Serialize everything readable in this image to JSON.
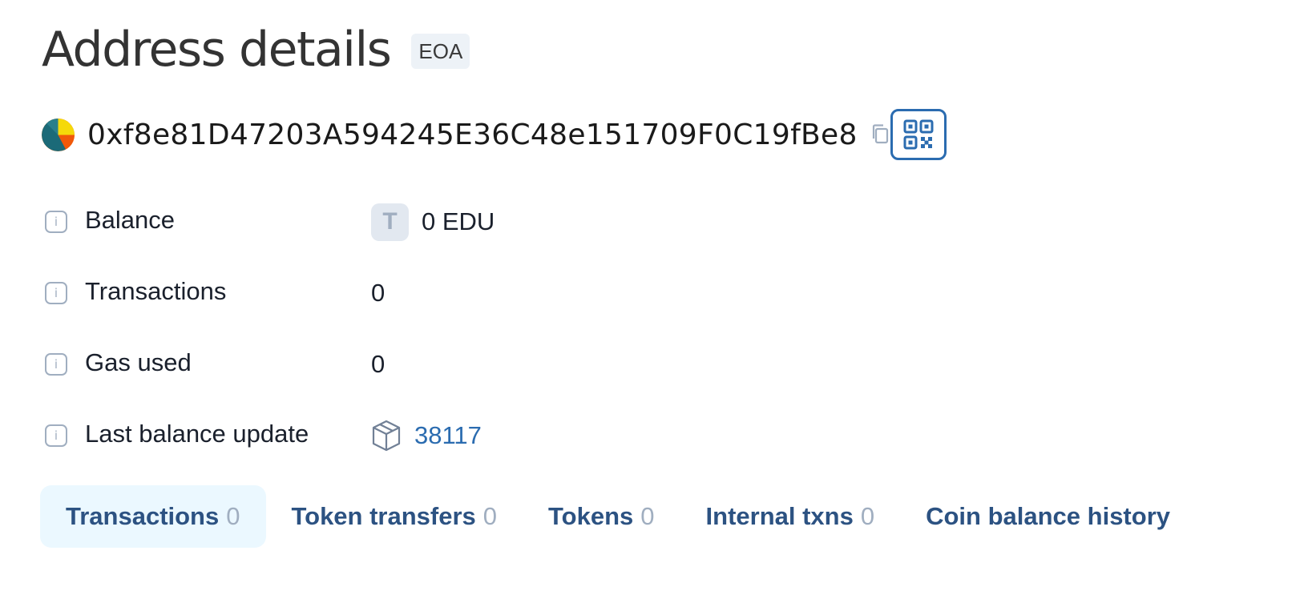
{
  "header": {
    "title": "Address details",
    "badge": "EOA"
  },
  "address": {
    "hash": "0xf8e81D47203A594245E36C48e151709F0C19fBe8",
    "avatar_icon": "identicon-avatar",
    "copy_icon": "copy-icon",
    "qr_icon": "qr-code-icon"
  },
  "details": [
    {
      "label": "Balance",
      "value": "0 EDU",
      "icon": "token-icon",
      "icon_letter": "T"
    },
    {
      "label": "Transactions",
      "value": "0"
    },
    {
      "label": "Gas used",
      "value": "0"
    },
    {
      "label": "Last balance update",
      "value": "38117",
      "icon": "block-icon"
    }
  ],
  "tabs": [
    {
      "label": "Transactions",
      "count": "0",
      "active": true
    },
    {
      "label": "Token transfers",
      "count": "0"
    },
    {
      "label": "Tokens",
      "count": "0"
    },
    {
      "label": "Internal txns",
      "count": "0"
    },
    {
      "label": "Coin balance history",
      "count": ""
    }
  ],
  "colors": {
    "accent": "#2b6cb0",
    "tab_text": "#2c5282",
    "active_tab_bg": "#ebf8ff",
    "muted": "#a0aec0"
  }
}
